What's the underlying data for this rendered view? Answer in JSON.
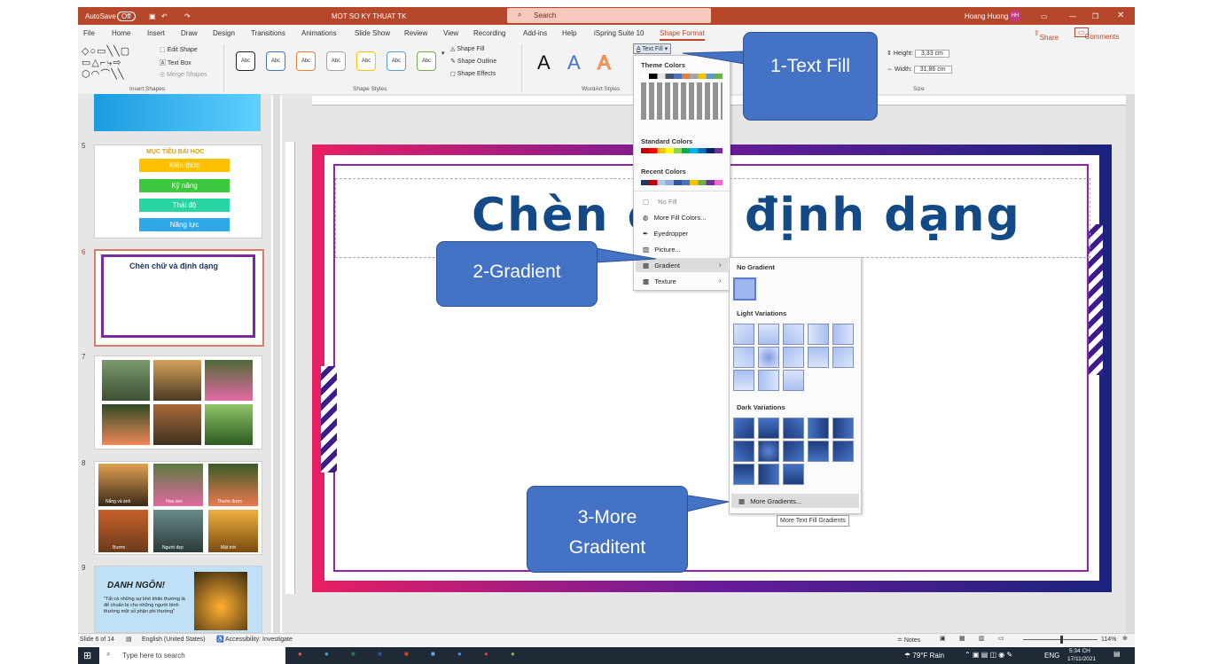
{
  "titlebar": {
    "autosave": "AutoSave",
    "autosave_state": "Off",
    "filename": "MOT SO KY THUAT TK",
    "search_placeholder": "Search",
    "user": "Hoang Huong",
    "initials": "HH"
  },
  "tabs": [
    "File",
    "Home",
    "Insert",
    "Draw",
    "Design",
    "Transitions",
    "Animations",
    "Slide Show",
    "Review",
    "View",
    "Recording",
    "Add-ins",
    "Help",
    "iSpring Suite 10",
    "Shape Format"
  ],
  "share_label": "Share",
  "comments_label": "Comments",
  "ribbon": {
    "edit_shape": "Edit Shape",
    "text_box": "Text Box",
    "merge_shapes": "Merge Shapes",
    "insert_shapes": "Insert Shapes",
    "style_abc": "Abc",
    "shape_styles": "Shape Styles",
    "shape_fill": "Shape Fill",
    "shape_outline": "Shape Outline",
    "shape_effects": "Shape Effects",
    "text_fill": "Text Fill",
    "wordart_styles": "WordArt Styles",
    "wordart_a": "A",
    "height_label": "Height:",
    "height_value": "3,33 cm",
    "width_label": "Width:",
    "width_value": "31,86 cm",
    "size": "Size"
  },
  "menu": {
    "theme_colors": "Theme Colors",
    "standard_colors": "Standard Colors",
    "recent_colors": "Recent Colors",
    "no_fill": "No Fill",
    "more_fill_colors": "More Fill Colors...",
    "eyedropper": "Eyedropper",
    "picture": "Picture...",
    "gradient": "Gradient",
    "texture": "Texture"
  },
  "gradient_menu": {
    "no_gradient": "No Gradient",
    "light_variations": "Light Variations",
    "dark_variations": "Dark Variations",
    "more_gradients": "More Gradients...",
    "tooltip": "More Text Fill Gradients"
  },
  "colors": {
    "accent": "#b7472a",
    "dark_grad": "#2f5597",
    "light_grad": "#b4c7e7",
    "callout": "#4472c4"
  },
  "callouts": {
    "c1": "1-Text Fill",
    "c2": "2-Gradient",
    "c3": "3-More Graditent"
  },
  "slides": [
    {
      "num": "5",
      "title": "MỤC TIÊU BÀI HỌC",
      "items": [
        "Kiến thức",
        "Kỹ năng",
        "Thái độ",
        "Năng lực"
      ]
    },
    {
      "num": "6",
      "title": "Chèn chữ và định dạng"
    },
    {
      "num": "7"
    },
    {
      "num": "8",
      "captions": [
        "Nắng và ánh",
        "Hoa sen",
        "Thước được",
        "Bươm",
        "Người đẹp",
        "Mặt trời"
      ]
    },
    {
      "num": "9",
      "title": "DANH NGÔN!",
      "quote": "\"Tất cả những sự khó khăn thường là để chuẩn bị cho những người bình thường một số phận phi thường\"",
      "author": "- C.S. Lewis"
    }
  ],
  "slide_title_visible": "Chèn ch",
  "slide_title_visible_2": "định dạng",
  "status": {
    "slide": "Slide 6 of 14",
    "language": "English (United States)",
    "accessibility": "Accessibility: Investigate",
    "notes": "Notes",
    "zoom": "114%"
  },
  "taskbar": {
    "search": "Type here to search",
    "weather": "79°F Rain",
    "lang": "ENG",
    "time": "5:34 CH",
    "date": "17/11/2021"
  }
}
